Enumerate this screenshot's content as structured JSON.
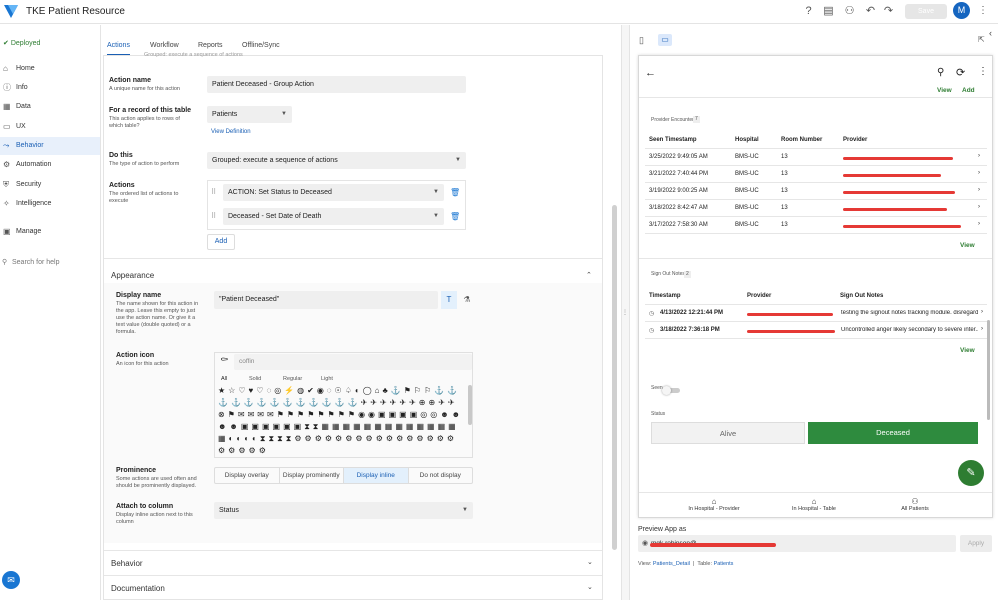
{
  "header": {
    "title": "TKE Patient Resource",
    "save_label": "Save",
    "avatar": "M"
  },
  "sidebar": {
    "status": "Deployed",
    "items": [
      {
        "label": "Home"
      },
      {
        "label": "Info"
      },
      {
        "label": "Data"
      },
      {
        "label": "UX"
      },
      {
        "label": "Behavior"
      },
      {
        "label": "Automation"
      },
      {
        "label": "Security"
      },
      {
        "label": "Intelligence"
      },
      {
        "label": "Manage"
      }
    ],
    "search_placeholder": "Search for help"
  },
  "tabs": [
    "Actions",
    "Workflow",
    "Reports",
    "Offline/Sync"
  ],
  "form": {
    "cut_text": "Grouped: execute a sequence of actions",
    "action_name": {
      "label": "Action name",
      "desc": "A unique name for this action",
      "value": "Patient Deceased - Group Action"
    },
    "for_record": {
      "label": "For a record of this table",
      "desc": "This action applies to rows of which table?",
      "value": "Patients",
      "link": "View Definition"
    },
    "do_this": {
      "label": "Do this",
      "desc": "The type of action to perform",
      "value": "Grouped: execute a sequence of actions"
    },
    "actions": {
      "label": "Actions",
      "desc": "The ordered list of actions to execute",
      "items": [
        "ACTION: Set Status to Deceased",
        "Deceased - Set Date of Death"
      ],
      "add_label": "Add"
    },
    "appearance": {
      "title": "Appearance"
    },
    "display_name": {
      "label": "Display name",
      "desc": "The name shown for this action in the app. Leave this empty to just use the action name. Or give it a text value (double quoted) or a formula.",
      "value": "\"Patient Deceased\""
    },
    "action_icon": {
      "label": "Action icon",
      "desc": "An icon for this action",
      "search_value": "coffin",
      "filters": [
        "All",
        "Solid",
        "Regular",
        "Light"
      ]
    },
    "prominence": {
      "label": "Prominence",
      "desc": "Some actions are used often and should be prominently displayed.",
      "options": [
        "Display overlay",
        "Display prominently",
        "Display inline",
        "Do not display"
      ]
    },
    "attach": {
      "label": "Attach to column",
      "desc": "Display inline action next to this column",
      "value": "Status"
    },
    "behavior_section": "Behavior",
    "documentation_section": "Documentation"
  },
  "preview": {
    "top_links": [
      "View",
      "Add"
    ],
    "encounters": {
      "title": "Provider Encounters",
      "count": "7",
      "columns": [
        "Seen Timestamp",
        "Hospital",
        "Room Number",
        "Provider"
      ],
      "rows": [
        [
          "3/25/2022 9:49:05 AM",
          "BMS-UC",
          "13"
        ],
        [
          "3/21/2022 7:40:44 PM",
          "BMS-UC",
          "13"
        ],
        [
          "3/19/2022 9:00:25 AM",
          "BMS-UC",
          "13"
        ],
        [
          "3/18/2022 8:42:47 AM",
          "BMS-UC",
          "13"
        ],
        [
          "3/17/2022 7:58:30 AM",
          "BMS-UC",
          "13"
        ]
      ],
      "view": "View"
    },
    "notes": {
      "title": "Sign Out Notes",
      "count": "2",
      "columns": [
        "Timestamp",
        "Provider",
        "Sign Out Notes"
      ],
      "rows": [
        [
          "4/13/2022 12:21:44 PM",
          "testing the signout notes tracking module. disregard"
        ],
        [
          "3/18/2022 7:36:18 PM",
          "Uncontrolled anger likely secondary to severe inter..."
        ]
      ],
      "view": "View"
    },
    "seen_label": "Seen",
    "status_label": "Status",
    "status_options": [
      "Alive",
      "Deceased"
    ],
    "bottom_nav": [
      "In Hospital - Provider",
      "In Hospital - Table",
      "All Patients"
    ],
    "preview_as_label": "Preview App as",
    "preview_as_value": "mgk.robinson@",
    "apply_label": "Apply",
    "footer": {
      "view_label": "View:",
      "view_value": "Patients_Detail",
      "table_label": "Table:",
      "table_value": "Patients"
    }
  }
}
